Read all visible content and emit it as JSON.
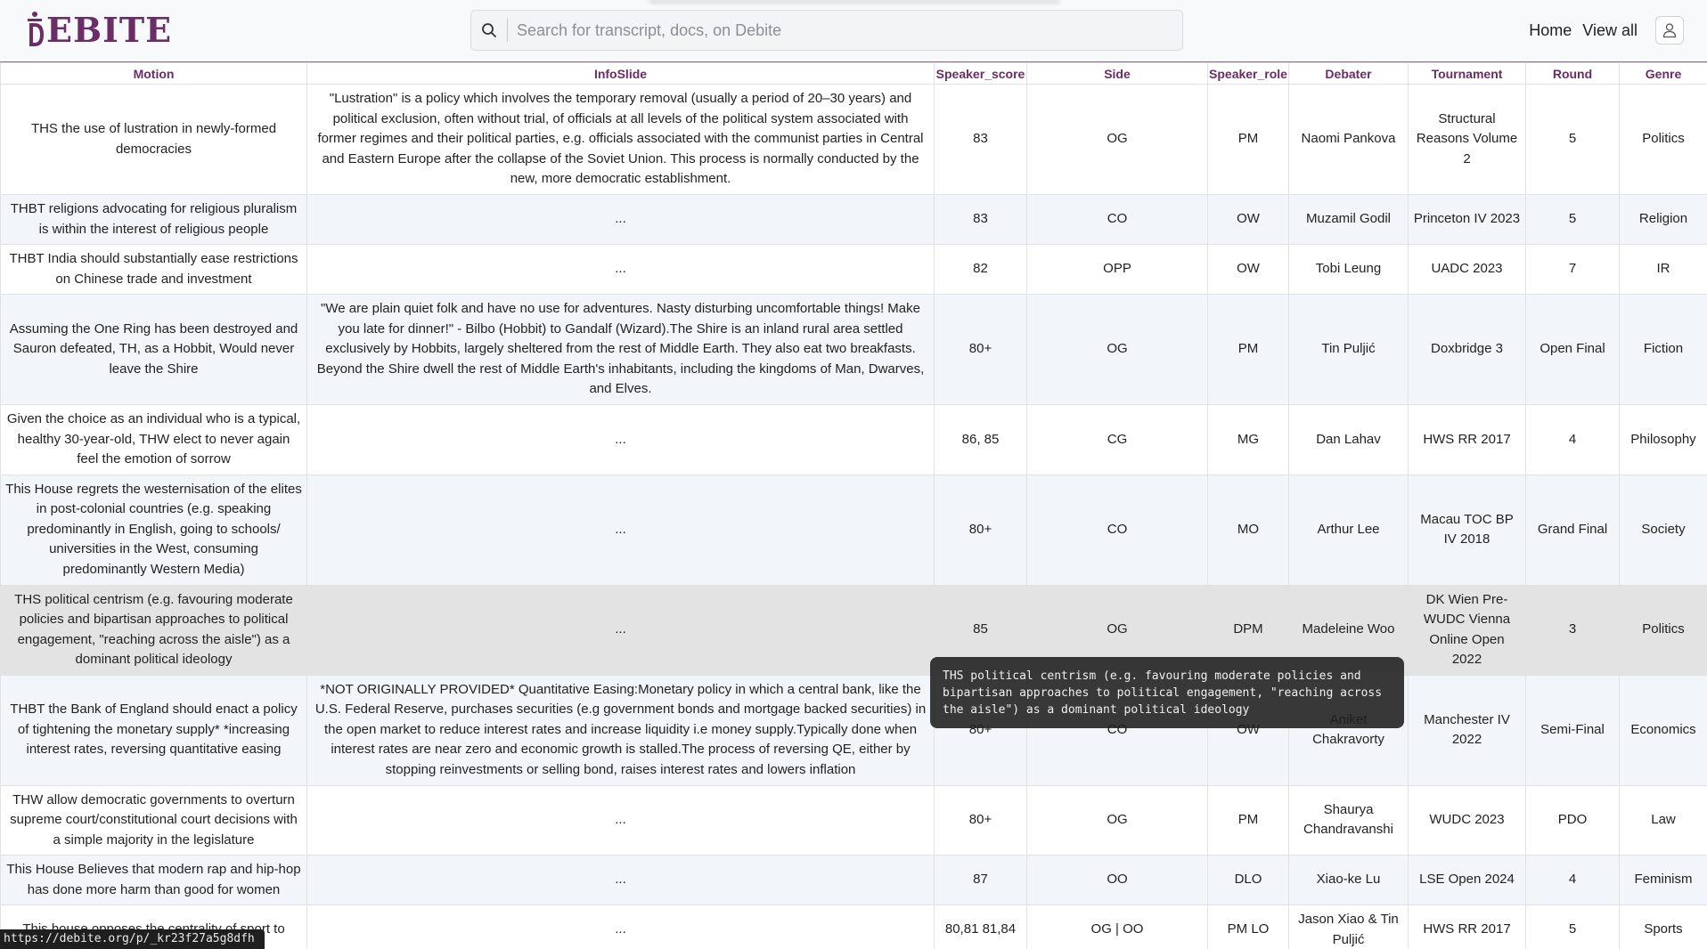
{
  "app": {
    "logo_text": "EBITE",
    "brand_color": "#6b2d66"
  },
  "search": {
    "placeholder": "Search for transcript, docs, on Debite",
    "value": ""
  },
  "nav": {
    "home": "Home",
    "view_all": "View all"
  },
  "table": {
    "columns": [
      "Motion",
      "InfoSlide",
      "Speaker_score",
      "Side",
      "Speaker_role",
      "Debater",
      "Tournament",
      "Round",
      "Genre"
    ],
    "rows": [
      {
        "motion": "THS the use of lustration in newly-formed democracies",
        "infoslide": "\"Lustration\" is a policy which involves the temporary removal (usually a period of 20–30 years) and political exclusion, often without trial, of officials at all levels of the political system associated with former regimes and their political parties, e.g. officials associated with the communist parties in Central and Eastern Europe after the collapse of the Soviet Union. This process is normally conducted by the new, more democratic establishment.",
        "score": "83",
        "side": "OG",
        "role": "PM",
        "debater": "Naomi Pankova",
        "tournament": "Structural Reasons Volume 2",
        "round": "5",
        "genre": "Politics"
      },
      {
        "motion": "THBT religions advocating for religious pluralism is within the interest of religious people",
        "infoslide": "...",
        "score": "83",
        "side": "CO",
        "role": "OW",
        "debater": "Muzamil Godil",
        "tournament": "Princeton IV 2023",
        "round": "5",
        "genre": "Religion"
      },
      {
        "motion": "THBT India should substantially ease restrictions on Chinese trade and investment",
        "infoslide": "...",
        "score": "82",
        "side": "OPP",
        "role": "OW",
        "debater": "Tobi Leung",
        "tournament": "UADC 2023",
        "round": "7",
        "genre": "IR"
      },
      {
        "motion": "Assuming the One Ring has been destroyed and Sauron defeated, TH, as a Hobbit, Would never leave the Shire",
        "infoslide": "\"We are plain quiet folk and have no use for adventures. Nasty disturbing uncomfortable things! Make you late for dinner!\" - Bilbo (Hobbit) to Gandalf (Wizard).The Shire is an inland rural area settled exclusively by Hobbits, largely sheltered from the rest of Middle Earth. They also eat two breakfasts. Beyond the Shire dwell the rest of Middle Earth's inhabitants, including the kingdoms of Man, Dwarves, and Elves.",
        "score": "80+",
        "side": "OG",
        "role": "PM",
        "debater": "Tin Puljić",
        "tournament": "Doxbridge 3",
        "round": "Open Final",
        "genre": "Fiction"
      },
      {
        "motion": "Given the choice as an individual who is a typical, healthy 30-year-old, THW elect to never again feel the emotion of sorrow",
        "infoslide": "...",
        "score": "86, 85",
        "side": "CG",
        "role": "MG",
        "debater": "Dan Lahav",
        "tournament": "HWS RR 2017",
        "round": "4",
        "genre": "Philosophy"
      },
      {
        "motion": "This House regrets the westernisation of the elites in post-colonial countries (e.g. speaking predominantly in English, going to schools/ universities in the West, consuming predominantly Western Media)",
        "infoslide": "...",
        "score": "80+",
        "side": "CO",
        "role": "MO",
        "debater": "Arthur Lee",
        "tournament": "Macau TOC BP IV 2018",
        "round": "Grand Final",
        "genre": "Society"
      },
      {
        "motion": "THS political centrism (e.g. favouring moderate policies and bipartisan approaches to political engagement, \"reaching across the aisle\") as a dominant political ideology",
        "infoslide": "...",
        "score": "85",
        "side": "OG",
        "role": "DPM",
        "debater": "Madeleine Woo",
        "tournament": "DK Wien Pre-WUDC Vienna Online Open 2022",
        "round": "3",
        "genre": "Politics"
      },
      {
        "motion": "THBT the Bank of England should enact a policy of tightening the monetary supply* *increasing interest rates, reversing quantitative easing",
        "infoslide": "*NOT ORIGINALLY PROVIDED* Quantitative Easing:Monetary policy in which a central bank, like the U.S. Federal Reserve, purchases securities (e.g government bonds and mortgage backed securities) in the open market to reduce interest rates and increase liquidity i.e money supply.Typically done when interest rates are near zero and economic growth is stalled.The process of reversing QE, either by stopping reinvestments or selling bond, raises interest rates and lowers inflation",
        "score": "80+",
        "side": "CO",
        "role": "OW",
        "debater": "Aniket Chakravorty",
        "tournament": "Manchester IV 2022",
        "round": "Semi-Final",
        "genre": "Economics"
      },
      {
        "motion": "THW allow democratic governments to overturn supreme court/constitutional court decisions with a simple majority in the legislature",
        "infoslide": "...",
        "score": "80+",
        "side": "OG",
        "role": "PM",
        "debater": "Shaurya Chandravanshi",
        "tournament": "WUDC 2023",
        "round": "PDO",
        "genre": "Law"
      },
      {
        "motion": "This House Believes that modern rap and hip-hop has done more harm than good for women",
        "infoslide": "...",
        "score": "87",
        "side": "OO",
        "role": "DLO",
        "debater": "Xiao-ke Lu",
        "tournament": "LSE Open 2024",
        "round": "4",
        "genre": "Feminism"
      },
      {
        "motion": "This house opposes the centrality of sport to",
        "infoslide": "...",
        "score": "80,81 81,84",
        "side": "OG | OO",
        "role": "PM LO",
        "debater": "Jason Xiao & Tin Puljić",
        "tournament": "HWS RR 2017",
        "round": "5",
        "genre": "Sports"
      }
    ]
  },
  "tooltip": {
    "text": "THS political centrism (e.g. favouring moderate policies and bipartisan approaches to political engagement, \"reaching across the aisle\") as a dominant political ideology"
  },
  "status_url": "https://debite.org/p/_kr23f27a5g8dfh"
}
